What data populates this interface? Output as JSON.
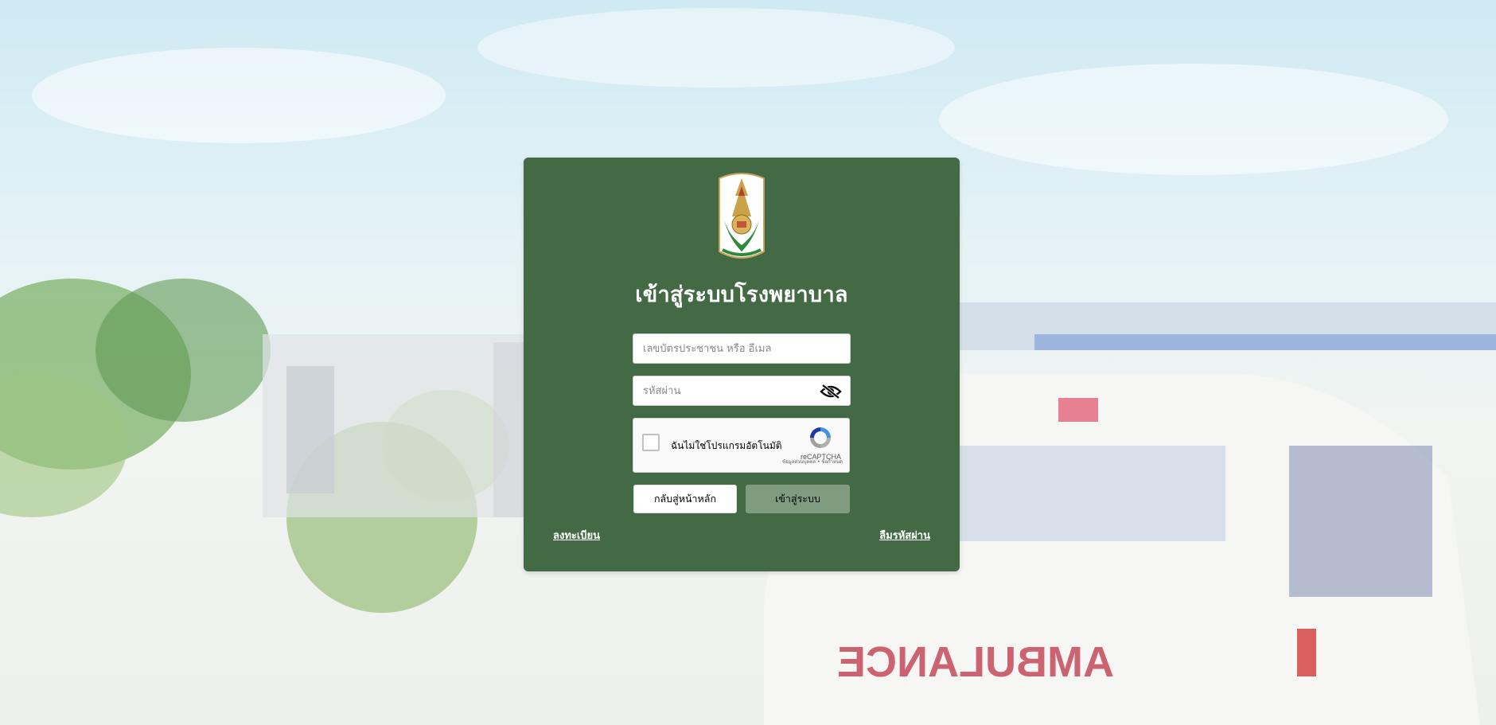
{
  "page": {
    "title": "เข้าสู่ระบบโรงพยาบาล"
  },
  "login_form": {
    "username_placeholder": "เลขบัตรประชาชน หรือ อีเมล",
    "password_placeholder": "รหัสผ่าน",
    "password_toggle_icon": "eye-slash-icon",
    "back_button_label": "กลับสู่หน้าหลัก",
    "login_button_label": "เข้าสู่ระบบ",
    "register_link": "ลงทะเบียน",
    "forgot_password_link": "ลืมรหัสผ่าน"
  },
  "recaptcha": {
    "checkbox_label": "ฉันไม่ใช่โปรแกรมอัตโนมัติ",
    "brand": "reCAPTCHA",
    "links": "ข้อมูลส่วนบุคคล • ข้อกำหนด"
  },
  "background": {
    "vehicle_text": "AMBULANCE"
  },
  "colors": {
    "card_background": "#436a45",
    "login_button": "#7f9c80",
    "title_text": "#ffffff"
  }
}
